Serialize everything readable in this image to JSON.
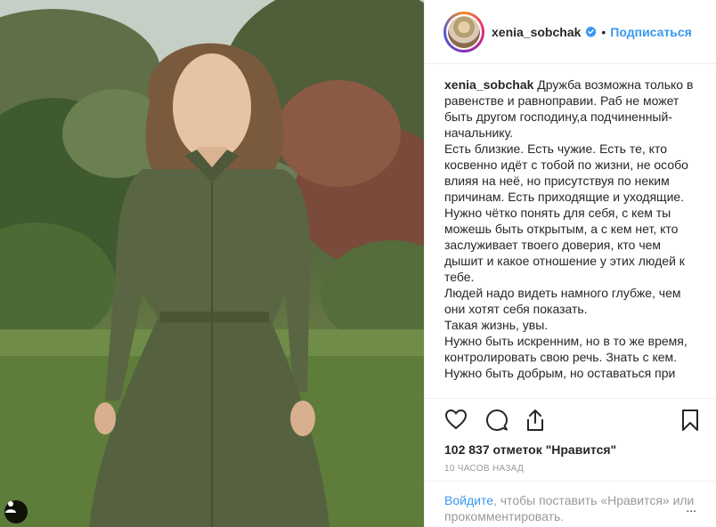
{
  "post": {
    "username": "xenia_sobchak",
    "separator": "•",
    "follow_label": "Подписаться",
    "caption_text": " Дружба возможна только в равенстве и равноправии. Раб не может быть другом господину,а подчиненный-начальнику.\nЕсть близкие. Есть чужие. Есть те, кто косвенно идёт с тобой по жизни, не особо влияя на неё, но присутствуя по неким причинам. Есть приходящие и уходящие.\nНужно чётко понять для себя, с кем ты можешь быть открытым, а с кем нет, кто заслуживает твоего доверия, кто чем дышит и какое отношение у этих людей к тебе.\nЛюдей надо видеть намного глубже, чем они хотят себя показать.\nТакая жизнь, увы.\nНужно быть искренним, но в то же время, контролировать свою речь. Знать с кем.\nНужно быть добрым, но оставаться при",
    "likes": "102 837 отметок \"Нравится\"",
    "time": "10 часов назад",
    "login_link": "Войдите",
    "login_rest": ", чтобы поставить «Нравится» или прокомментировать.",
    "more": "..."
  },
  "icons": {
    "verified": "verified-badge-icon",
    "like": "heart-icon",
    "comment": "comment-icon",
    "share": "share-icon",
    "save": "bookmark-icon",
    "tag": "user-tag-icon"
  },
  "colors": {
    "link": "#3897f0",
    "text": "#262626",
    "muted": "#999999",
    "verified": "#3897f0"
  }
}
